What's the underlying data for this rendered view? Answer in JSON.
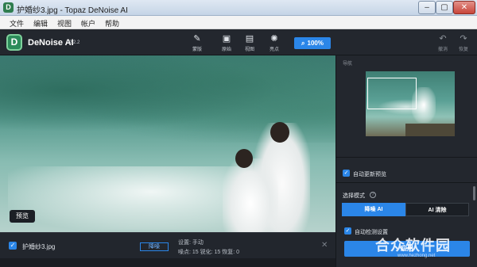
{
  "window": {
    "title": "护婚纱3.jpg - Topaz DeNoise AI",
    "min": "–",
    "max": "▢",
    "close": "✕"
  },
  "menu": [
    "文件",
    "编辑",
    "视图",
    "帐户",
    "帮助"
  ],
  "app": {
    "name": "DeNoise AI",
    "version": "v2.2.2",
    "logo": "D"
  },
  "tools": [
    {
      "icon": "brush-icon",
      "glyph": "✎",
      "label": "蒙版"
    },
    {
      "icon": "image-icon",
      "glyph": "▣",
      "label": "原始"
    },
    {
      "icon": "split-view-icon",
      "glyph": "▤",
      "label": "视图"
    },
    {
      "icon": "brightness-icon",
      "glyph": "✺",
      "label": "亮点"
    }
  ],
  "zoom": {
    "icon": "zoom-icon",
    "glyph": "⌕",
    "value": "100%"
  },
  "history": [
    {
      "icon": "undo-icon",
      "glyph": "↶",
      "label": "撤消"
    },
    {
      "icon": "redo-icon",
      "glyph": "↷",
      "label": "恢复"
    }
  ],
  "canvas": {
    "preview_label": "预览"
  },
  "file": {
    "name": "护婚纱3.jpg",
    "denoise_button": "降噪",
    "settings_line": "设置: 手动",
    "params_line": "噪点: 15  锐化: 15  恢复: 0"
  },
  "panel": {
    "nav_label": "导航",
    "auto_update": "自动更新预览",
    "mode_label": "选择模式",
    "mode_denoise": "降噪 AI",
    "mode_clear": "AI 清除",
    "auto_detect": "自动检测设置",
    "apply": "应用"
  },
  "watermark": {
    "text": "合众软件园",
    "url": "www.hezhong.net"
  },
  "colors": {
    "accent": "#2b86e8",
    "toolbar": "#23272e",
    "logo": "#2c8c5a"
  }
}
